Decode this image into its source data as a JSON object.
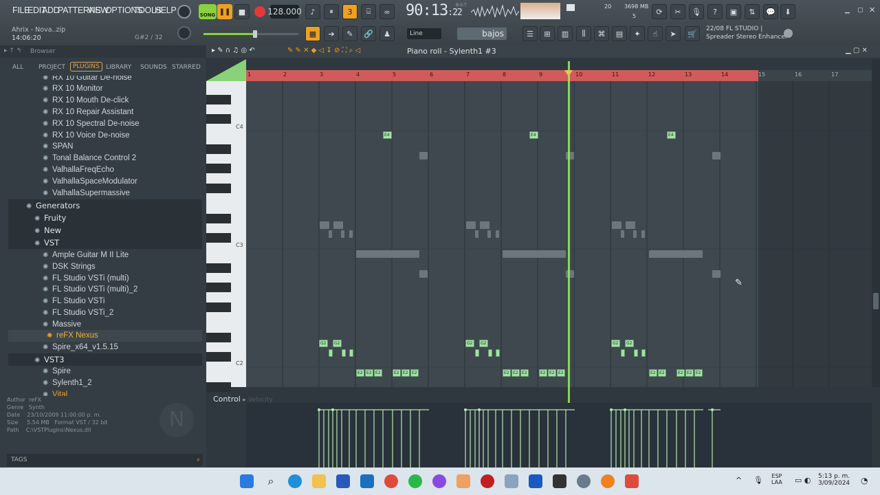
{
  "menu": [
    "FILE",
    "EDIT",
    "ADD",
    "PATTERNS",
    "VIEW",
    "OPTIONS",
    "TOOLS",
    "HELP"
  ],
  "project": {
    "name": "Ahrix - Nova..zip",
    "time": "14:06:20",
    "hint": "G#2 / 32"
  },
  "transport": {
    "song_label": "SONG",
    "tempo": "128.000",
    "time_main": "90:13",
    "time_ticks": "22",
    "bst": "B:S:T"
  },
  "monitor": {
    "cpu": "20",
    "ram": "3698 MB",
    "poly": "5"
  },
  "toolbar": {
    "snap": "Line",
    "pattern": "bajos",
    "hint_count": "22/08",
    "hint_app": "FL STUDIO |",
    "hint_plugin": "Spreader Stereo Enhancer"
  },
  "browser": {
    "title": "Browser",
    "tabs": [
      "ALL",
      "PROJECT",
      "PLUGINS",
      "LIBRARY",
      "SOUNDS",
      "STARRED"
    ],
    "effects": [
      "RX 10 Guitar De-noise",
      "RX 10 Monitor",
      "RX 10 Mouth De-click",
      "RX 10 Repair Assistant",
      "RX 10 Spectral De-noise",
      "RX 10 Voice De-noise",
      "SPAN",
      "Tonal Balance Control 2",
      "ValhallaFreqEcho",
      "ValhallaSpaceModulator",
      "ValhallaSupermassive"
    ],
    "folders": {
      "generators": "Generators",
      "fruity": "Fruity",
      "new": "New",
      "vst": "VST",
      "vst3": "VST3"
    },
    "vst": [
      "Ample Guitar M II Lite",
      "DSK Strings",
      "FL Studio VSTi (multi)",
      "FL Studio VSTi (multi)_2",
      "FL Studio VSTi",
      "FL Studio VSTi_2",
      "Massive",
      "reFX Nexus",
      "Spire_x64_v1.5.15"
    ],
    "vst3": [
      "Spire",
      "Sylenth1_2",
      "Vital"
    ],
    "info": {
      "author_k": "Author",
      "author": "reFX",
      "genre_k": "Genre",
      "genre": "Synth",
      "date_k": "Date",
      "date": "23/10/2009 11:00:00 p. m.",
      "size_k": "Size",
      "size": "5.54 MB",
      "format_k": "Format",
      "format": "VST / 32 bit",
      "path_k": "Path",
      "path": "C:\\VSTPlugins\\Nexus.dll"
    },
    "tags_label": "TAGS"
  },
  "pianoroll": {
    "title": "Piano roll - Sylenth1 #3",
    "bars": [
      "1",
      "2",
      "3",
      "4",
      "5",
      "6",
      "7",
      "8",
      "9",
      "10",
      "11",
      "12",
      "13",
      "14",
      "15",
      "16",
      "17"
    ],
    "keys": {
      "c4": "C4",
      "c3": "C3",
      "c2": "C2"
    },
    "control_label": "Control",
    "control_sub": "Velocity"
  },
  "notes": {
    "e4": "E4",
    "g2": "G2",
    "e2": "E2"
  },
  "taskbar": {
    "lang1": "ESP",
    "lang2": "LAA",
    "time": "5:13 p. m.",
    "date": "3/09/2024"
  }
}
